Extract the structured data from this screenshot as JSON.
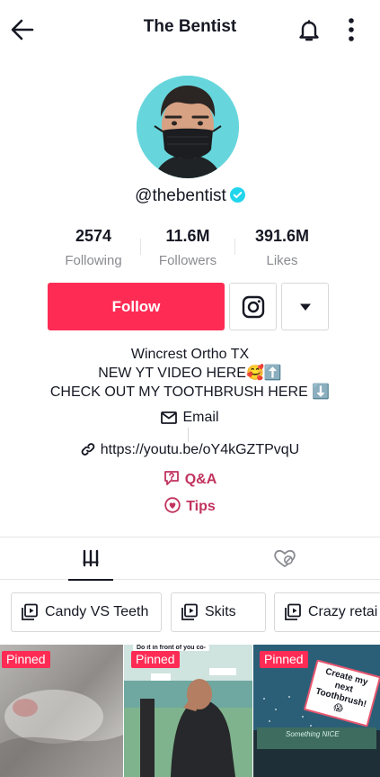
{
  "header": {
    "title": "The Bentist"
  },
  "profile": {
    "username": "@thebentist"
  },
  "stats": [
    {
      "value": "2574",
      "label": "Following"
    },
    {
      "value": "11.6M",
      "label": "Followers"
    },
    {
      "value": "391.6M",
      "label": "Likes"
    }
  ],
  "actions": {
    "follow_label": "Follow"
  },
  "bio": {
    "lines": [
      "Wincrest Ortho TX",
      "NEW YT VIDEO HERE🥰⬆️",
      "CHECK OUT MY TOOTHBRUSH HERE ⬇️"
    ]
  },
  "contact": {
    "email_label": "Email",
    "link": "https://youtu.be/oY4kGZTPvqU",
    "qa_label": "Q&A",
    "tips_label": "Tips"
  },
  "playlists": [
    "Candy VS Teeth",
    "Skits",
    "Crazy retai"
  ],
  "videos": [
    {
      "badge": "Pinned"
    },
    {
      "badge": "Pinned",
      "sticker": "Do it in front of you co-"
    },
    {
      "badge": "Pinned",
      "sticker": "Create my next Toothbrush! 😱",
      "sign": "Something NICE"
    }
  ],
  "colors": {
    "accent": "#fe2c55",
    "link_pink": "#c1335e",
    "verified": "#20d5ec",
    "avatar_bg": "#67d6dc"
  }
}
